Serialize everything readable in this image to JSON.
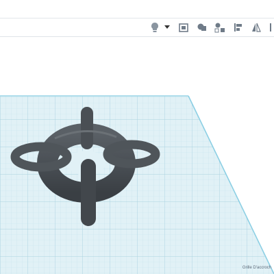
{
  "toolbar": {
    "buttons": [
      {
        "name": "light-bulb-icon",
        "label": "Notes"
      },
      {
        "name": "dropdown-arrow-icon",
        "label": "Notes menu"
      },
      {
        "name": "workplane-icon",
        "label": "Workplane"
      },
      {
        "name": "group-icon",
        "label": "Group"
      },
      {
        "name": "ungroup-icon",
        "label": "Ungroup"
      },
      {
        "name": "align-icon",
        "label": "Align"
      },
      {
        "name": "mirror-icon",
        "label": "Mirror"
      },
      {
        "name": "more-icon",
        "label": "More"
      }
    ],
    "icon_color": "#6f7b88"
  },
  "workspace": {
    "grid_label": "Grille D'accroch",
    "grid_color": "#dff0f5",
    "grid_line_color": "#b9dbe6",
    "edge_color": "#8fd2e6",
    "model_color": "#4c5156"
  }
}
